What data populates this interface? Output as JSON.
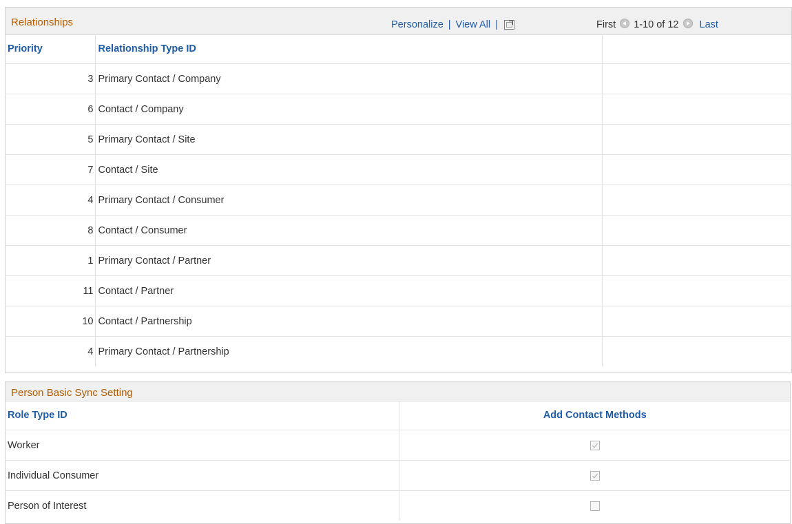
{
  "relationships": {
    "title": "Relationships",
    "nav": {
      "personalize": "Personalize",
      "separator": "|",
      "view_all": "View All",
      "first": "First",
      "range": "1-10 of 12",
      "last": "Last"
    },
    "columns": {
      "priority": "Priority",
      "relationship_type_id": "Relationship Type ID"
    },
    "rows": [
      {
        "priority": "3",
        "type": "Primary Contact / Company"
      },
      {
        "priority": "6",
        "type": "Contact / Company"
      },
      {
        "priority": "5",
        "type": "Primary Contact / Site"
      },
      {
        "priority": "7",
        "type": "Contact / Site"
      },
      {
        "priority": "4",
        "type": "Primary Contact / Consumer"
      },
      {
        "priority": "8",
        "type": "Contact / Consumer"
      },
      {
        "priority": "1",
        "type": "Primary Contact / Partner"
      },
      {
        "priority": "11",
        "type": "Contact / Partner"
      },
      {
        "priority": "10",
        "type": "Contact / Partnership"
      },
      {
        "priority": "4",
        "type": "Primary Contact / Partnership"
      }
    ]
  },
  "person_sync": {
    "title": "Person Basic Sync Setting",
    "columns": {
      "role_type_id": "Role Type ID",
      "add_contact_methods": "Add Contact Methods"
    },
    "rows": [
      {
        "role": "Worker",
        "add_contact_methods": true
      },
      {
        "role": "Individual Consumer",
        "add_contact_methods": true
      },
      {
        "role": "Person of Interest",
        "add_contact_methods": false
      }
    ]
  },
  "colors": {
    "title_text": "#b35c00",
    "link": "#1f5ca8",
    "header_bg": "#f0f0f0"
  }
}
